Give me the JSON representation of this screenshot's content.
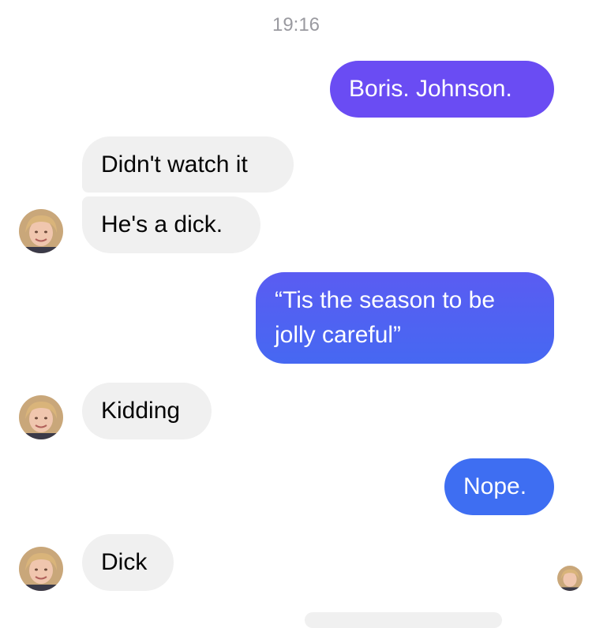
{
  "chat": {
    "timestamp": "19:16",
    "messages": [
      {
        "id": "m1",
        "from": "me",
        "text": "Boris. Johnson."
      },
      {
        "id": "m2",
        "from": "contact",
        "text": "Didn't watch it"
      },
      {
        "id": "m3",
        "from": "contact",
        "text": "He's a dick."
      },
      {
        "id": "m4",
        "from": "me",
        "text": "“Tis the season to be\njolly careful”"
      },
      {
        "id": "m5",
        "from": "contact",
        "text": "Kidding"
      },
      {
        "id": "m6",
        "from": "me",
        "text": "Nope."
      },
      {
        "id": "m7",
        "from": "contact",
        "text": "Dick"
      }
    ]
  },
  "colors": {
    "incoming_bubble": "#f0f0f0",
    "outgoing_top": "#6a4cf3",
    "outgoing_mid": "#5563f2",
    "outgoing_bottom": "#3e6ef2",
    "timestamp": "#9a9aa0"
  },
  "icons": {
    "contact_avatar": "contact-avatar-photo",
    "read_receipt": "read-receipt-avatar"
  }
}
